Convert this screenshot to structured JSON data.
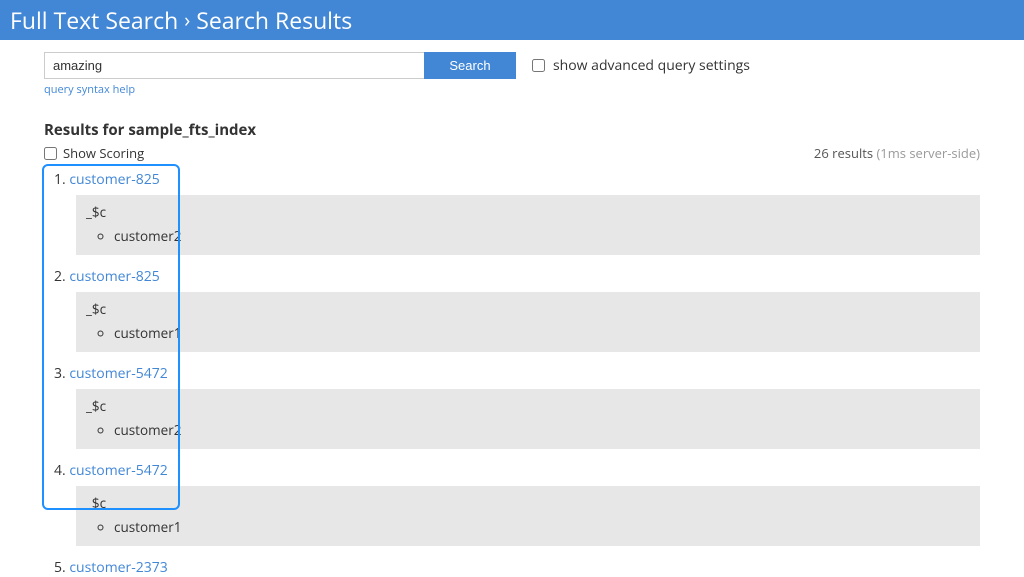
{
  "banner": {
    "breadcrumb1": "Full Text Search",
    "breadcrumb2": "Search Results"
  },
  "search": {
    "value": "amazing",
    "button": "Search",
    "advanced_label": "show advanced query settings",
    "syntax_help": "query syntax help"
  },
  "results_header": {
    "title": "Results for sample_fts_index",
    "show_scoring": "Show Scoring",
    "count_prefix": "26 results",
    "count_suffix": "(1ms server-side)"
  },
  "results": [
    {
      "n": "1.",
      "id": "customer-825",
      "field": "_$c",
      "value": "customer2"
    },
    {
      "n": "2.",
      "id": "customer-825",
      "field": "_$c",
      "value": "customer1"
    },
    {
      "n": "3.",
      "id": "customer-5472",
      "field": "_$c",
      "value": "customer2"
    },
    {
      "n": "4.",
      "id": "customer-5472",
      "field": "_$c",
      "value": "customer1"
    },
    {
      "n": "5.",
      "id": "customer-2373",
      "field": "",
      "value": ""
    }
  ]
}
